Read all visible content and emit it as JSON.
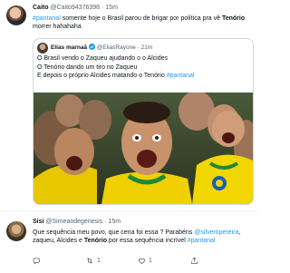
{
  "tweet1": {
    "author_name": "Caito",
    "handle": "@Caito94376398",
    "time": "15m",
    "hashtag": "#pantanal",
    "text_before": " somente hoje o Brasil parou de brigar por política pra vê ",
    "bold_word": "Tenório",
    "text_after": " morrer hahahaha",
    "quote": {
      "author_name": "Elias marnaã",
      "handle": "@EliasRayone",
      "time": "21m",
      "line1": "O Brasil vendo o Zaqueu ajudando o o Alcides",
      "line2": "O Tenório dando um tiro no Zaqueu",
      "line3_text": "E depois o próprio Alcides matando o Tenório ",
      "line3_hashtag": "#pantanal"
    },
    "actions": {
      "likes": ""
    }
  },
  "tweet2": {
    "author_name": "Sisi",
    "handle": "@Simeaodegenesis",
    "time": "15m",
    "text_a": "Que sequência meu povo, que cena foi essa ? Parabéns ",
    "mention": "@silveropereira",
    "text_b": ",",
    "text_c": "zaqueu,  Alcides e ",
    "bold_word": "Tenório",
    "text_d": " por essa sequência incrível ",
    "hashtag": "#pantanal",
    "actions": {
      "retweets": "1",
      "likes": "1"
    }
  },
  "icons": {
    "reply": "reply-icon",
    "retweet": "retweet-icon",
    "like": "heart-icon",
    "share": "share-icon",
    "verified": "verified-badge-icon"
  },
  "colors": {
    "link": "#1d9bf0",
    "muted": "#536471",
    "border": "#cfd9de"
  }
}
